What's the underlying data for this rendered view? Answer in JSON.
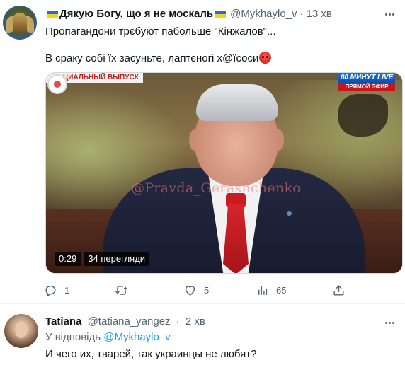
{
  "main_tweet": {
    "display_name": "Дякую Богу, що я не москаль",
    "handle": "@Mykhaylo_v",
    "separator": "·",
    "time": "13 хв",
    "text_line1": "Пропагандони трєбуют пабольше \"Кінжалов\"...",
    "text_line2": "В сраку собі їх засуньте, лаптєногі х@їсоси",
    "video": {
      "channel_banner": "ЦИАЛЬНЫЙ ВЫПУСК",
      "live_top": "60 МИНУТ  LIVE",
      "live_bottom": "ПРЯМОЙ ЭФИР",
      "watermark": "@Pravda_Gerashchenko",
      "duration": "0:29",
      "views": "34 перегляди"
    },
    "actions": {
      "replies": "1",
      "retweets": "",
      "likes": "5",
      "views": "65"
    },
    "icons": [
      "flag-ukraine-icon",
      "angry-face-emoji",
      "reply-icon",
      "retweet-icon",
      "heart-icon",
      "views-chart-icon",
      "share-icon",
      "more-icon"
    ]
  },
  "reply_tweet": {
    "display_name": "Tatiana",
    "handle": "@tatiana_yangez",
    "separator": "·",
    "time": "2 хв",
    "replying_to_label": "У відповідь",
    "replying_to_handle": "@Mykhaylo_v",
    "text": "И чего их, тварей, так украинцы не любят?"
  },
  "colors": {
    "text_primary": "#0f1419",
    "text_secondary": "#536471",
    "link": "#1d9bf0",
    "border": "#eff3f4"
  }
}
